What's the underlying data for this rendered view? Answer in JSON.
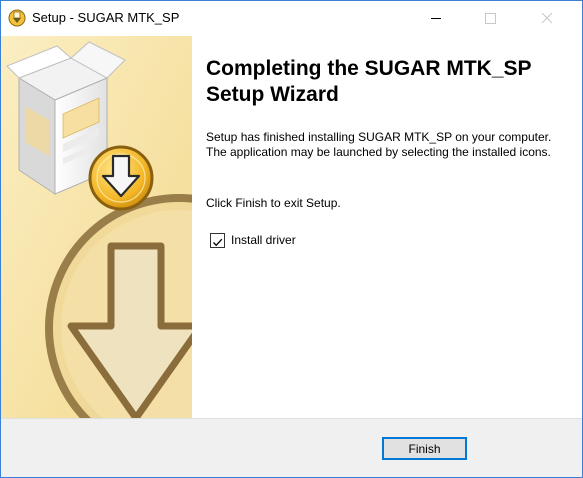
{
  "window": {
    "title": "Setup - SUGAR MTK_SP"
  },
  "content": {
    "heading": "Completing the SUGAR MTK_SP Setup Wizard",
    "paragraph1": "Setup has finished installing SUGAR MTK_SP on your computer. The application may be launched by selecting the installed icons.",
    "paragraph2": "Click Finish to exit Setup.",
    "checkbox_label": "Install driver",
    "checkbox_checked": true
  },
  "footer": {
    "finish_label": "Finish"
  },
  "colors": {
    "accent": "#0078d7",
    "window_border": "#3c7fd6",
    "side_panel": "#f6e6b2",
    "footer_bg": "#f0f0f0"
  },
  "icons": [
    "setup-app-icon",
    "minimize-icon",
    "maximize-icon",
    "close-icon",
    "install-box-icon",
    "download-arrow-icon",
    "check-icon"
  ]
}
